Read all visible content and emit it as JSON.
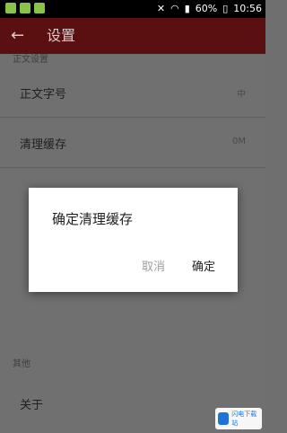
{
  "status_bar": {
    "battery": "60%",
    "time": "10:56"
  },
  "app_bar": {
    "back_icon": "arrow-left-icon",
    "title": "设置"
  },
  "settings": {
    "section_text": "正文设置",
    "rows": [
      {
        "label": "正文字号",
        "value": "中"
      },
      {
        "label": "清理缓存",
        "value": "0M"
      }
    ],
    "section_other": "其他",
    "about_label": "关于"
  },
  "dialog": {
    "title": "确定清理缓存",
    "cancel_label": "取消",
    "ok_label": "确定"
  },
  "watermark": {
    "text": "闪电下载站"
  }
}
